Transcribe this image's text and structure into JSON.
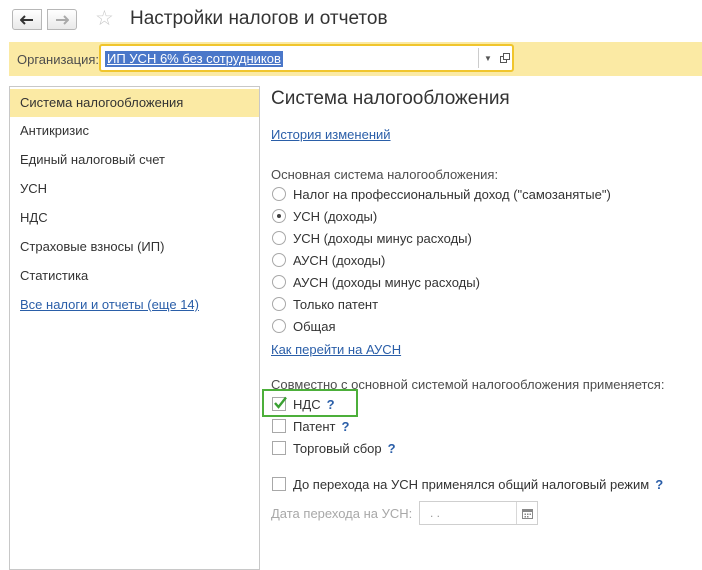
{
  "window": {
    "title": "Настройки налогов и отчетов",
    "back_icon": "arrow-left-icon",
    "forward_icon": "arrow-right-icon",
    "favorite_icon": "star-icon"
  },
  "organization": {
    "label": "Организация:",
    "value": "ИП УСН 6% без сотрудников"
  },
  "sidebar": {
    "items": [
      {
        "label": "Система налогообложения",
        "active": true
      },
      {
        "label": "Антикризис"
      },
      {
        "label": "Единый налоговый счет"
      },
      {
        "label": "УСН"
      },
      {
        "label": "НДС"
      },
      {
        "label": "Страховые взносы (ИП)"
      },
      {
        "label": "Статистика"
      }
    ],
    "all_link": "Все налоги и отчеты (еще 14)"
  },
  "main": {
    "title": "Система налогообложения",
    "history_link": "История изменений",
    "tax_system_label": "Основная система налогообложения:",
    "tax_systems": [
      {
        "label": "Налог на профессиональный доход (\"самозанятые\")",
        "selected": false
      },
      {
        "label": "УСН (доходы)",
        "selected": true
      },
      {
        "label": "УСН (доходы минус расходы)",
        "selected": false
      },
      {
        "label": "АУСН (доходы)",
        "selected": false
      },
      {
        "label": "АУСН (доходы минус расходы)",
        "selected": false
      },
      {
        "label": "Только патент",
        "selected": false
      },
      {
        "label": "Общая",
        "selected": false
      }
    ],
    "ausn_link": "Как перейти на АУСН",
    "combined_label": "Совместно с основной системой налогообложения применяется:",
    "combined": [
      {
        "label": "НДС",
        "checked": true,
        "help": "?"
      },
      {
        "label": "Патент",
        "checked": false,
        "help": "?"
      },
      {
        "label": "Торговый сбор",
        "checked": false,
        "help": "?"
      }
    ],
    "previous_regime": {
      "label": "До перехода на УСН применялся общий налоговый режим",
      "checked": false,
      "help": "?"
    },
    "transition_date": {
      "label": "Дата перехода на УСН:",
      "value": " .  . "
    }
  },
  "colors": {
    "accent_yellow": "#fbeaa4",
    "field_border": "#f0c52c",
    "link": "#2a5ea8",
    "check_green": "#4caf3a"
  }
}
